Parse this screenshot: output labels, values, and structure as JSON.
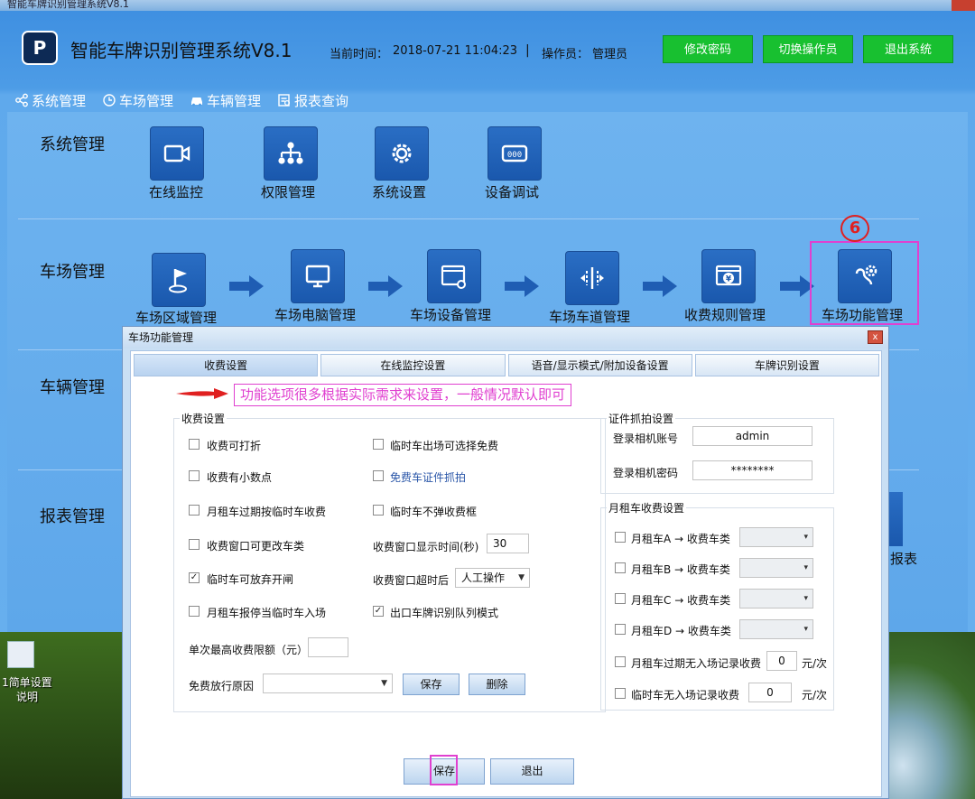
{
  "window": {
    "title": "智能车牌识别管理系统V8.1"
  },
  "header": {
    "logo_letter": "P",
    "app_title": "智能车牌识别管理系统V8.1",
    "clock_label": "当前时间：",
    "clock_value": "2018-07-21 11:04:23",
    "separator": "|",
    "operator_label": "操作员：",
    "operator_value": "管理员",
    "buttons": [
      "修改密码",
      "切换操作员",
      "退出系统"
    ],
    "accent_color": "#18c030"
  },
  "nav": {
    "items": [
      {
        "label": "系统管理",
        "icon": "share-icon"
      },
      {
        "label": "车场管理",
        "icon": "clock-icon"
      },
      {
        "label": "车辆管理",
        "icon": "car-icon"
      },
      {
        "label": "报表查询",
        "icon": "report-icon"
      }
    ]
  },
  "sections": {
    "system": {
      "label": "系统管理",
      "tiles": [
        {
          "label": "在线监控",
          "icon": "camera-icon"
        },
        {
          "label": "权限管理",
          "icon": "org-chart-icon"
        },
        {
          "label": "系统设置",
          "icon": "gear-icon"
        },
        {
          "label": "设备调试",
          "icon": "display-device-icon"
        }
      ]
    },
    "parking": {
      "label": "车场管理",
      "tiles": [
        {
          "label": "车场区域管理",
          "icon": "flag-icon"
        },
        {
          "label": "车场电脑管理",
          "icon": "monitor-icon"
        },
        {
          "label": "车场设备管理",
          "icon": "device-settings-icon"
        },
        {
          "label": "车场车道管理",
          "icon": "lane-icon"
        },
        {
          "label": "收费规则管理",
          "icon": "yuan-icon"
        },
        {
          "label": "车场功能管理",
          "icon": "function-gear-icon"
        }
      ]
    },
    "vehicle": {
      "label": "车辆管理"
    },
    "report": {
      "label": "报表管理",
      "partial_tile_label": "报表"
    }
  },
  "step_badge": "6",
  "desktop": {
    "icon_label": "1简单设置说明"
  },
  "dialog": {
    "title": "车场功能管理",
    "close": "x",
    "tabs": [
      "收费设置",
      "在线监控设置",
      "语音/显示模式/附加设备设置",
      "车牌识别设置"
    ],
    "note": "功能选项很多根据实际需求来设置，一般情况默认即可",
    "fee": {
      "legend": "收费设置",
      "options": [
        {
          "label": "收费可打折",
          "checked": false
        },
        {
          "label": "临时车出场可选择免费",
          "checked": false
        },
        {
          "label": "收费有小数点",
          "checked": false
        },
        {
          "label": "免费车证件抓拍",
          "checked": false
        },
        {
          "label": "月租车过期按临时车收费",
          "checked": false
        },
        {
          "label": "临时车不弹收费框",
          "checked": false
        },
        {
          "label": "收费窗口可更改车类",
          "checked": false
        },
        {
          "label": "临时车可放弃开闸",
          "checked": true
        },
        {
          "label": "月租车报停当临时车入场",
          "checked": false
        },
        {
          "label": "出口车牌识别队列模式",
          "checked": true
        }
      ],
      "display_time_label": "收费窗口显示时间(秒)",
      "display_time_value": "30",
      "timeout_label": "收费窗口超时后",
      "timeout_value": "人工操作",
      "max_fee_label": "单次最高收费限额（元）",
      "max_fee_value": "",
      "free_reason_label": "免费放行原因",
      "free_reason_value": "",
      "save": "保存",
      "delete": "删除"
    },
    "capture": {
      "legend": "证件抓拍设置",
      "account_label": "登录相机账号",
      "account_value": "admin",
      "password_label": "登录相机密码",
      "password_value": "********"
    },
    "monthly": {
      "legend": "月租车收费设置",
      "rows": [
        {
          "label": "月租车A  →  收费车类"
        },
        {
          "label": "月租车B  →  收费车类"
        },
        {
          "label": "月租车C  →  收费车类"
        },
        {
          "label": "月租车D →  收费车类"
        }
      ],
      "expired_label": "月租车过期无入场记录收费",
      "expired_value": "0",
      "temp_label": "临时车无入场记录收费",
      "temp_value": "0",
      "unit": "元/次"
    },
    "footer": {
      "save": "保存",
      "exit": "退出"
    }
  }
}
